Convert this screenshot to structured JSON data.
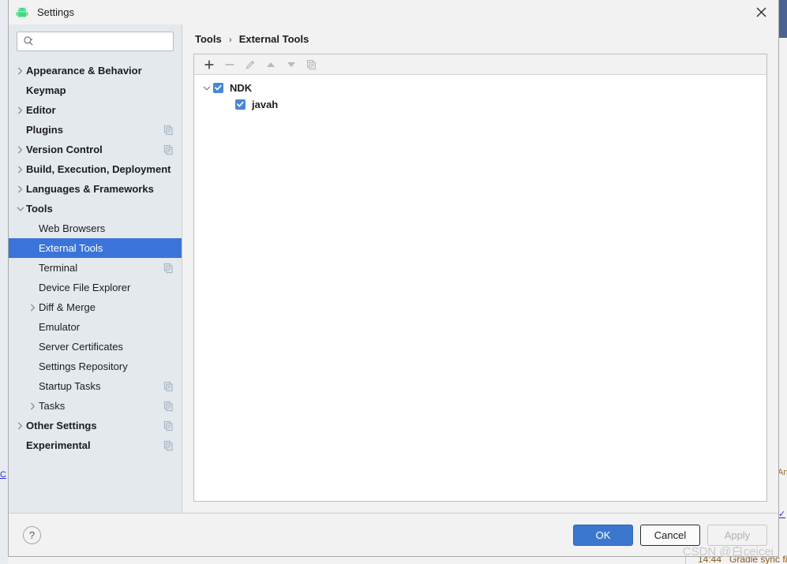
{
  "window": {
    "title": "Settings",
    "app_icon": "android-robot-icon",
    "close_label": "×"
  },
  "search": {
    "placeholder": "",
    "value": "",
    "icon": "search-icon"
  },
  "sidebar": {
    "items": [
      {
        "label": "Appearance & Behavior",
        "level": 0,
        "bold": true,
        "arrow": "chevron-right",
        "copy": false,
        "selected": false
      },
      {
        "label": "Keymap",
        "level": 0,
        "bold": true,
        "arrow": "none",
        "copy": false,
        "selected": false
      },
      {
        "label": "Editor",
        "level": 0,
        "bold": true,
        "arrow": "chevron-right",
        "copy": false,
        "selected": false
      },
      {
        "label": "Plugins",
        "level": 0,
        "bold": true,
        "arrow": "none",
        "copy": true,
        "selected": false
      },
      {
        "label": "Version Control",
        "level": 0,
        "bold": true,
        "arrow": "chevron-right",
        "copy": true,
        "selected": false
      },
      {
        "label": "Build, Execution, Deployment",
        "level": 0,
        "bold": true,
        "arrow": "chevron-right",
        "copy": false,
        "selected": false
      },
      {
        "label": "Languages & Frameworks",
        "level": 0,
        "bold": true,
        "arrow": "chevron-right",
        "copy": false,
        "selected": false
      },
      {
        "label": "Tools",
        "level": 0,
        "bold": true,
        "arrow": "chevron-down",
        "copy": false,
        "selected": false
      },
      {
        "label": "Web Browsers",
        "level": 1,
        "bold": false,
        "arrow": "none",
        "copy": false,
        "selected": false
      },
      {
        "label": "External Tools",
        "level": 1,
        "bold": false,
        "arrow": "none",
        "copy": false,
        "selected": true
      },
      {
        "label": "Terminal",
        "level": 1,
        "bold": false,
        "arrow": "none",
        "copy": true,
        "selected": false
      },
      {
        "label": "Device File Explorer",
        "level": 1,
        "bold": false,
        "arrow": "none",
        "copy": false,
        "selected": false
      },
      {
        "label": "Diff & Merge",
        "level": 1,
        "bold": false,
        "arrow": "chevron-right",
        "copy": false,
        "selected": false
      },
      {
        "label": "Emulator",
        "level": 1,
        "bold": false,
        "arrow": "none",
        "copy": false,
        "selected": false
      },
      {
        "label": "Server Certificates",
        "level": 1,
        "bold": false,
        "arrow": "none",
        "copy": false,
        "selected": false
      },
      {
        "label": "Settings Repository",
        "level": 1,
        "bold": false,
        "arrow": "none",
        "copy": false,
        "selected": false
      },
      {
        "label": "Startup Tasks",
        "level": 1,
        "bold": false,
        "arrow": "none",
        "copy": true,
        "selected": false
      },
      {
        "label": "Tasks",
        "level": 1,
        "bold": false,
        "arrow": "chevron-right",
        "copy": true,
        "selected": false
      },
      {
        "label": "Other Settings",
        "level": 0,
        "bold": true,
        "arrow": "chevron-right",
        "copy": true,
        "selected": false
      },
      {
        "label": "Experimental",
        "level": 0,
        "bold": true,
        "arrow": "none",
        "copy": true,
        "selected": false
      }
    ]
  },
  "main": {
    "breadcrumb": {
      "parent": "Tools",
      "separator": "›",
      "current": "External Tools"
    },
    "toolbar": [
      {
        "name": "add-button",
        "icon": "plus-icon",
        "enabled": true
      },
      {
        "name": "remove-button",
        "icon": "minus-icon",
        "enabled": false
      },
      {
        "name": "edit-button",
        "icon": "pencil-icon",
        "enabled": false
      },
      {
        "name": "move-up-button",
        "icon": "arrow-up-icon",
        "enabled": false
      },
      {
        "name": "move-down-button",
        "icon": "arrow-down-icon",
        "enabled": false
      },
      {
        "name": "copy-button",
        "icon": "copy-icon",
        "enabled": false
      }
    ],
    "tools_tree": [
      {
        "label": "NDK",
        "level": 0,
        "checked": true,
        "expanded": true,
        "twisty": "chevron-down"
      },
      {
        "label": "javah",
        "level": 1,
        "checked": true,
        "expanded": false,
        "twisty": "none"
      }
    ]
  },
  "footer": {
    "help_label": "?",
    "buttons": [
      {
        "label": "OK",
        "style": "primary",
        "enabled": true
      },
      {
        "label": "Cancel",
        "style": "normal",
        "enabled": true
      },
      {
        "label": "Apply",
        "style": "disabled",
        "enabled": false
      }
    ],
    "watermark": "CSDN @白ceicei"
  },
  "background": {
    "left_marker": "C",
    "right_marker": "✓",
    "right_text": "An",
    "status_time": "14:44",
    "status_message": "Gradle sync fi"
  },
  "colors": {
    "accent": "#3b74d8",
    "selection": "#3b74d8",
    "checkbox": "#4a86d8",
    "sidebar_bg": "#e4e9ee",
    "dialog_bg": "#f2f2f2",
    "panel_bg": "#ffffff",
    "android_green": "#3ddc84",
    "primary_button": "#3b77cf"
  }
}
